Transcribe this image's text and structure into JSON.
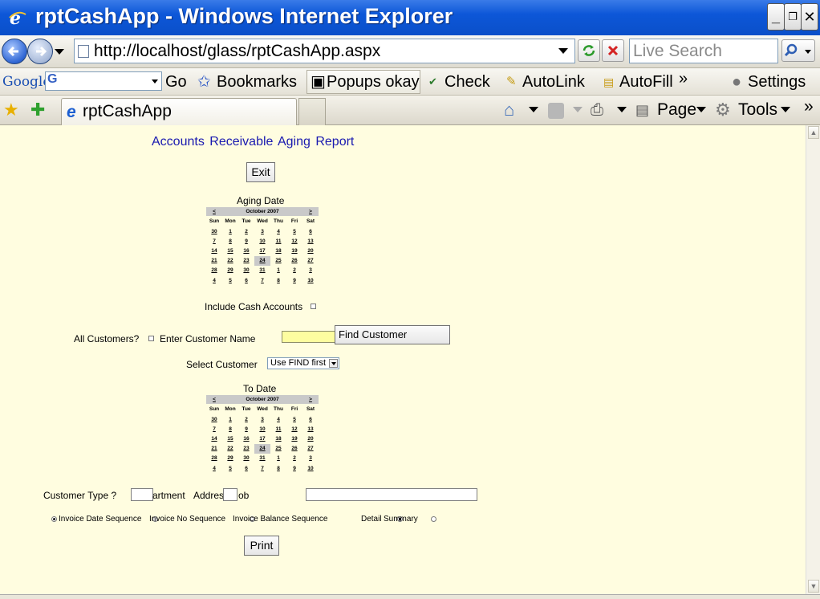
{
  "window": {
    "title": "rptCashApp - Windows Internet Explorer",
    "minimize": "_",
    "restore": "❐",
    "close": "✕"
  },
  "address_bar": {
    "url": "http://localhost/glass/rptCashApp.aspx",
    "search_placeholder": "Live Search"
  },
  "google_toolbar": {
    "logo": "Google",
    "g_label": "G",
    "go_label": "Go",
    "bookmarks_label": "Bookmarks",
    "popups_label": "Popups okay",
    "check_label": "Check",
    "autolink_label": "AutoLink",
    "autofill_label": "AutoFill",
    "more_label": "»",
    "settings_label": "Settings"
  },
  "tabs": {
    "active_tab": "rptCashApp",
    "page_label": "Page",
    "tools_label": "Tools",
    "more_label": "»"
  },
  "report": {
    "title": "Accounts Receivable Aging Report",
    "exit_label": "Exit",
    "aging_date_label": "Aging Date",
    "to_date_label": "To Date",
    "include_cash_label": "Include Cash Accounts",
    "all_customers_label": "All Customers?",
    "enter_customer_label": "Enter Customer Name",
    "find_customer_label": "Find Customer",
    "select_customer_label": "Select Customer",
    "select_customer_value": "Use FIND first",
    "customer_type_label": "Customer Type ?",
    "department_label": "artment",
    "address_label": "Addres",
    "job_label": "ob",
    "invoice_date_seq": "Invoice Date Sequence",
    "invoice_no_seq": "Invoice No Sequence",
    "invoice_balance_seq": "Invoice Balance Sequence",
    "detail_label": "Detail",
    "summary_label": "Summary",
    "print_label": "Print"
  },
  "calendar": {
    "month_label": "October 2007",
    "prev": "<",
    "next": ">",
    "days": [
      "Sun",
      "Mon",
      "Tue",
      "Wed",
      "Thu",
      "Fri",
      "Sat"
    ],
    "weeks": [
      [
        "30",
        "1",
        "2",
        "3",
        "4",
        "5",
        "6"
      ],
      [
        "7",
        "8",
        "9",
        "10",
        "11",
        "12",
        "13"
      ],
      [
        "14",
        "15",
        "16",
        "17",
        "18",
        "19",
        "20"
      ],
      [
        "21",
        "22",
        "23",
        "24",
        "25",
        "26",
        "27"
      ],
      [
        "28",
        "29",
        "30",
        "31",
        "1",
        "2",
        "3"
      ],
      [
        "4",
        "5",
        "6",
        "7",
        "8",
        "9",
        "10"
      ]
    ],
    "selected": "24"
  }
}
